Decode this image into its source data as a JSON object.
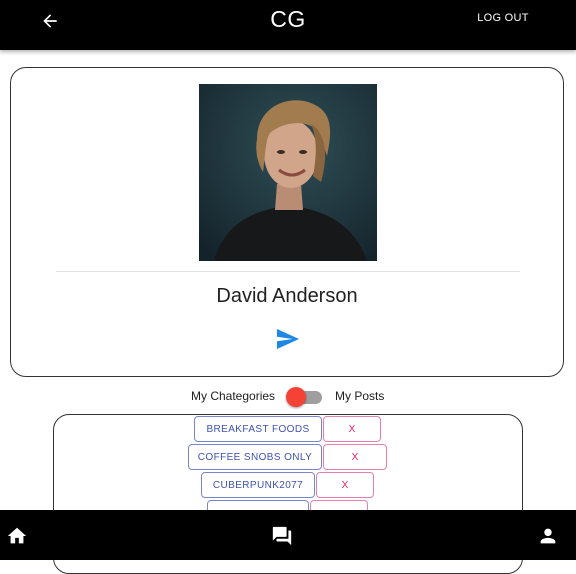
{
  "header": {
    "title": "CG",
    "logout_label": "LOG OUT",
    "back_icon": "arrow-left-icon"
  },
  "profile": {
    "name": "David Anderson",
    "avatar_icon": "profile-photo",
    "send_icon": "send-icon"
  },
  "toggle": {
    "left_label": "My Chategories",
    "right_label": "My Posts",
    "thumb_color": "#f44336"
  },
  "categories": [
    {
      "name": "BREAKFAST FOODS",
      "remove_label": "X"
    },
    {
      "name": "COFFEE SNOBS ONLY",
      "remove_label": "X"
    },
    {
      "name": "CUBERPUNK2077",
      "remove_label": "X"
    },
    {
      "name": "",
      "remove_label": ""
    }
  ],
  "colors": {
    "bar_background": "#000000",
    "category_text": "#3f51b5",
    "remove_text": "#e91e63",
    "send_icon": "#1e88e5"
  },
  "bottom_nav": {
    "home_icon": "home-icon",
    "chat_icon": "chat-icon",
    "profile_icon": "person-icon"
  }
}
